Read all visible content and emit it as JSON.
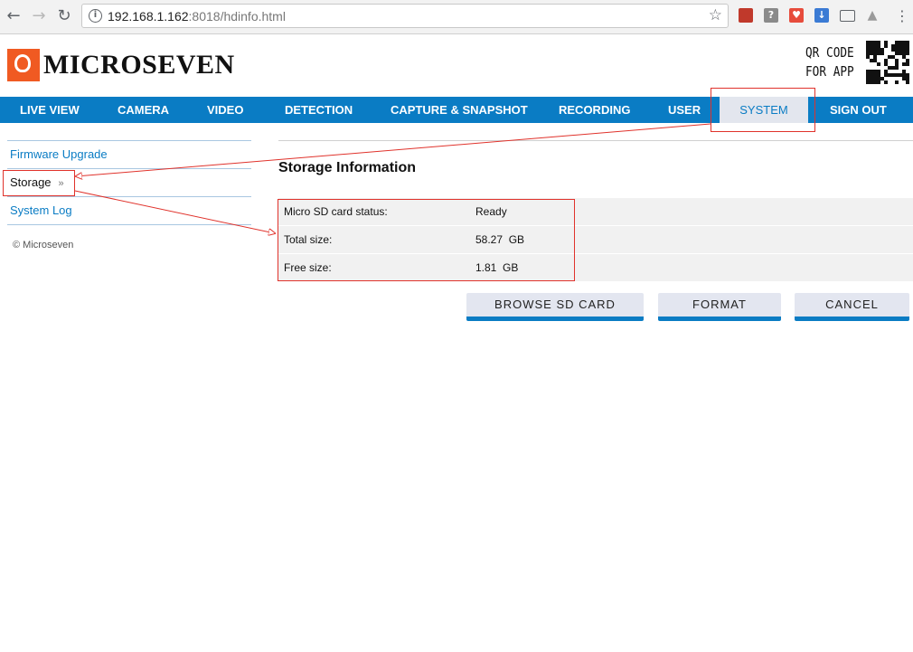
{
  "browser": {
    "url_host": "192.168.1.162",
    "url_rest": ":8018/hdinfo.html",
    "back_icon": "arrow-left-icon",
    "forward_icon": "arrow-right-icon",
    "reload_icon": "reload-icon",
    "info_icon": "info-icon",
    "star_icon": "star-icon"
  },
  "header": {
    "logo_text": "MICROSEVEN",
    "qr_label_1": "QR CODE",
    "qr_label_2": "FOR APP"
  },
  "nav": {
    "items": [
      {
        "label": "LIVE VIEW"
      },
      {
        "label": "CAMERA"
      },
      {
        "label": "VIDEO"
      },
      {
        "label": "DETECTION"
      },
      {
        "label": "CAPTURE & SNAPSHOT"
      },
      {
        "label": "RECORDING"
      },
      {
        "label": "USER"
      },
      {
        "label": "SYSTEM",
        "active": true
      },
      {
        "label": "SIGN OUT"
      }
    ],
    "color": "#0a7cc4"
  },
  "sidebar": {
    "items": [
      {
        "label": "Firmware Upgrade"
      },
      {
        "label": "Storage",
        "arrow": "»",
        "current": true
      },
      {
        "label": "System Log"
      }
    ],
    "copyright": "© Microseven"
  },
  "main": {
    "heading": "Storage Information",
    "rows": [
      {
        "label": "Micro SD card status:",
        "value": "Ready"
      },
      {
        "label": "Total size:",
        "value": "58.27  GB"
      },
      {
        "label": "Free size:",
        "value": "1.81  GB"
      }
    ],
    "buttons": {
      "browse": "BROWSE SD CARD",
      "format": "FORMAT",
      "cancel": "CANCEL"
    }
  },
  "annotation_color": "#e0322b"
}
